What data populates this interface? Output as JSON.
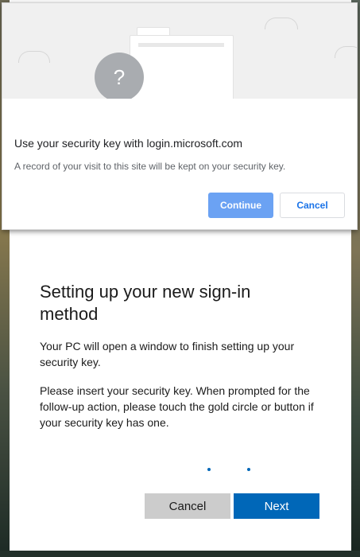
{
  "dialog": {
    "title": "Use your security key with login.microsoft.com",
    "subtitle": "A record of your visit to this site will be kept on your security key.",
    "continue_label": "Continue",
    "cancel_label": "Cancel",
    "illustration_icon": "question-mark",
    "illustration_symbol": "?",
    "accent_color": "#6ba2f3"
  },
  "card": {
    "title": "Setting up your new sign-in method",
    "paragraph_1": "Your PC will open a window to finish setting up your security key.",
    "paragraph_2": "Please insert your security key. When prompted for the follow-up action, please touch the gold circle or button if your security key has one.",
    "cancel_label": "Cancel",
    "next_label": "Next",
    "loading_indicator": "progress-dots",
    "primary_color": "#0067b8"
  }
}
